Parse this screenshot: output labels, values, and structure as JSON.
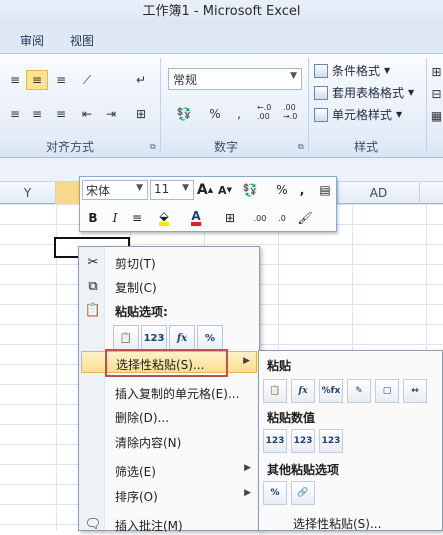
{
  "window": {
    "title": "工作簿1  -  Microsoft Excel"
  },
  "ribbon": {
    "tabs": [
      "审阅",
      "视图"
    ],
    "number_format": "常规",
    "styles": {
      "conditional": "条件格式",
      "table": "套用表格格式",
      "cell": "单元格样式"
    },
    "number_symbols": {
      "percent": "%",
      "comma": ",",
      "inc": "←.0 .00",
      "dec": ".00 →.0"
    },
    "groups": {
      "alignment": "对齐方式",
      "number": "数字",
      "styles": "样式"
    }
  },
  "grid": {
    "columns": [
      "Y",
      "AD"
    ]
  },
  "mini_toolbar": {
    "font": "宋体",
    "size": "11",
    "grow": "A",
    "shrink": "A",
    "percent": "%",
    "comma": ",",
    "bold": "B",
    "italic": "I"
  },
  "context_menu": {
    "cut": "剪切(T)",
    "copy": "复制(C)",
    "paste_options": "粘贴选项:",
    "paste_buttons": [
      "123",
      "fx",
      "%"
    ],
    "paste_special": "选择性粘贴(S)...",
    "insert_copied": "插入复制的单元格(E)...",
    "delete": "删除(D)...",
    "clear": "清除内容(N)",
    "filter": "筛选(E)",
    "sort": "排序(O)",
    "insert_comment": "插入批注(M)"
  },
  "submenu": {
    "paste": "粘贴",
    "paste_values": "粘贴数值",
    "values_buttons": [
      "123",
      "123",
      "123"
    ],
    "other": "其他粘贴选项",
    "paste_special": "选择性粘贴(S)..."
  },
  "colors": {
    "highlight": "#fbdf8f",
    "red_box": "#c0504d",
    "accent": "#1c3f75"
  }
}
